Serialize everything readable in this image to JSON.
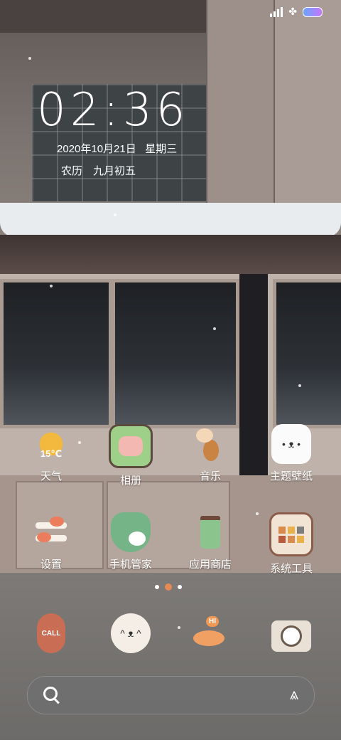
{
  "status_bar": {
    "signal_icon": "signal-icon",
    "clover_icon": "clover-icon",
    "battery_icon": "battery-icon"
  },
  "clock": {
    "time": "02:36",
    "date": "2020年10月21日",
    "weekday": "星期三",
    "lunar": "农历　九月初五"
  },
  "apps": {
    "weather": {
      "label": "天气",
      "badge": "15℃",
      "icon": "sunflower-weather-icon"
    },
    "album": {
      "label": "相册",
      "icon": "pig-photo-icon"
    },
    "music": {
      "label": "音乐",
      "icon": "cat-guitar-icon"
    },
    "themes": {
      "label": "主题壁纸",
      "icon": "white-cat-icon"
    },
    "settings": {
      "label": "设置",
      "icon": "fish-settings-icon"
    },
    "manager": {
      "label": "手机管家",
      "icon": "shield-bunny-icon"
    },
    "store": {
      "label": "应用商店",
      "icon": "cup-store-icon"
    },
    "tools": {
      "label": "系统工具",
      "icon": "tools-folder-icon"
    }
  },
  "dock": {
    "phone": {
      "icon": "call-phone-icon",
      "text": "CALL"
    },
    "contacts": {
      "icon": "cat-face-icon"
    },
    "messages": {
      "icon": "fish-hi-icon",
      "text": "HI"
    },
    "camera": {
      "icon": "camera-icon"
    }
  },
  "page_indicator": {
    "pages": 3,
    "current": 2
  },
  "search": {
    "search_icon": "search-icon",
    "assistant_icon": "assistant-icon"
  }
}
